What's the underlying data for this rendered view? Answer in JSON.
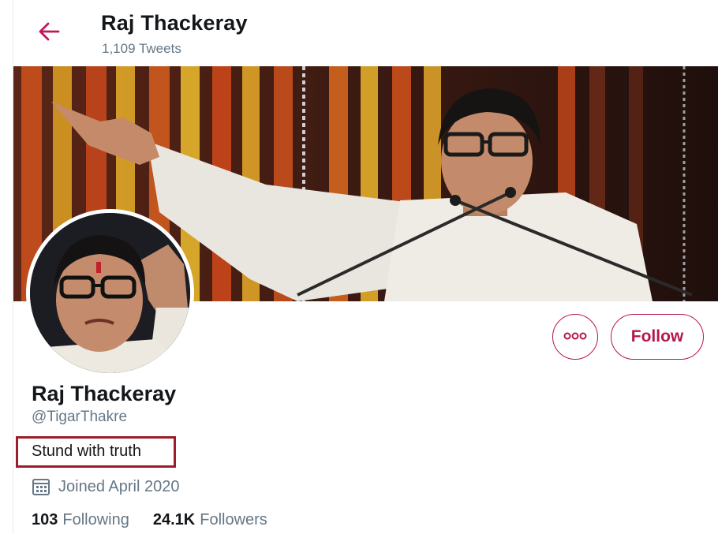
{
  "header": {
    "title": "Raj Thackeray",
    "tweet_count": "1,109 Tweets",
    "back_icon": "arrow-left-icon"
  },
  "profile": {
    "name": "Raj Thackeray",
    "handle": "@TigarThakre",
    "bio": "Stund with truth",
    "joined": "Joined April 2020",
    "following_count": "103",
    "following_label": "Following",
    "followers_count": "24.1K",
    "followers_label": "Followers"
  },
  "actions": {
    "more_icon": "more-options-icon",
    "follow_label": "Follow"
  },
  "colors": {
    "accent": "#b5174a",
    "highlight_box": "#9b1c2b",
    "secondary_text": "#657786"
  }
}
